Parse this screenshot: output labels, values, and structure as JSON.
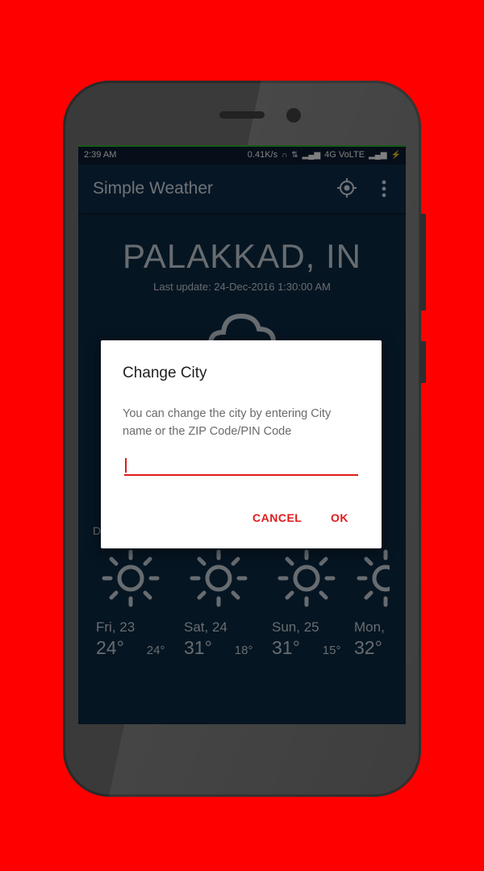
{
  "status_bar": {
    "time": "2:39 AM",
    "speed": "0.41K/s",
    "network": "4G VoLTE"
  },
  "app_bar": {
    "title": "Simple Weather",
    "icons": [
      "locate-icon",
      "more-vert-icon"
    ]
  },
  "weather": {
    "city": "PALAKKAD, IN",
    "last_update": "Last update: 24-Dec-2016 1:30:00 AM",
    "current_icon": "cloud-icon",
    "daily_label": "D"
  },
  "forecast": [
    {
      "day": "Fri, 23",
      "high": "24°",
      "low": "24°",
      "icon": "sun-icon"
    },
    {
      "day": "Sat, 24",
      "high": "31°",
      "low": "18°",
      "icon": "sun-icon"
    },
    {
      "day": "Sun, 25",
      "high": "31°",
      "low": "15°",
      "icon": "sun-icon"
    },
    {
      "day": "Mon,",
      "high": "32°",
      "low": "",
      "icon": "sun-icon"
    }
  ],
  "dialog": {
    "title": "Change City",
    "message": "You can change the city by entering City name or the ZIP Code/PIN Code",
    "input_value": "",
    "cancel_label": "CANCEL",
    "ok_label": "OK"
  },
  "colors": {
    "background": "#ff0000",
    "accent": "#e01b1b",
    "screen_bg": "#0d2a45"
  }
}
